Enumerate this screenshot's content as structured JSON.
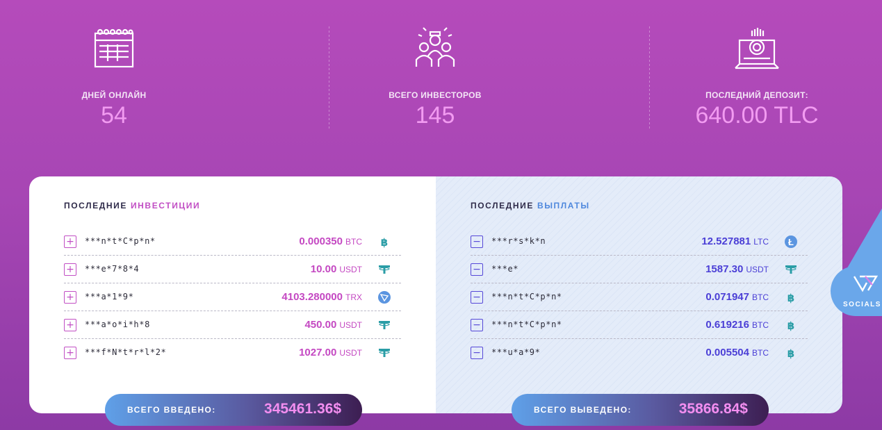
{
  "stats": [
    {
      "icon": "calendar-icon",
      "label": "ДНЕЙ ОНЛАЙН",
      "value": "54"
    },
    {
      "icon": "investors-icon",
      "label": "ВСЕГО ИНВЕСТОРОВ",
      "value": "145"
    },
    {
      "icon": "deposit-icon",
      "label": "ПОСЛЕДНИЙ ДЕПОЗИТ:",
      "value": "640.00 TLC"
    }
  ],
  "investments": {
    "title_prefix": "ПОСЛЕДНИЕ",
    "title_accent": "ИНВЕСТИЦИИ",
    "rows": [
      {
        "user": "***n*t*C*p*n*",
        "amount": "0.000350",
        "currency": "BTC",
        "coin": "bitcoin-icon"
      },
      {
        "user": "***e*7*8*4",
        "amount": "10.00",
        "currency": "USDT",
        "coin": "tether-icon"
      },
      {
        "user": "***a*1*9*",
        "amount": "4103.280000",
        "currency": "TRX",
        "coin": "tron-icon"
      },
      {
        "user": "***a*o*i*h*8",
        "amount": "450.00",
        "currency": "USDT",
        "coin": "tether-icon"
      },
      {
        "user": "***f*N*t*r*l*2*",
        "amount": "1027.00",
        "currency": "USDT",
        "coin": "tether-icon"
      }
    ],
    "total_label": "ВСЕГО ВВЕДЕНО:",
    "total_value": "345461.36$"
  },
  "payouts": {
    "title_prefix": "ПОСЛЕДНИЕ",
    "title_accent": "ВЫПЛАТЫ",
    "rows": [
      {
        "user": "***r*s*k*n",
        "amount": "12.527881",
        "currency": "LTC",
        "coin": "litecoin-icon"
      },
      {
        "user": "***e*",
        "amount": "1587.30",
        "currency": "USDT",
        "coin": "tether-icon"
      },
      {
        "user": "***n*t*C*p*n*",
        "amount": "0.071947",
        "currency": "BTC",
        "coin": "bitcoin-icon"
      },
      {
        "user": "***n*t*C*p*n*",
        "amount": "0.619216",
        "currency": "BTC",
        "coin": "bitcoin-icon"
      },
      {
        "user": "***u*a*9*",
        "amount": "0.005504",
        "currency": "BTC",
        "coin": "bitcoin-icon"
      }
    ],
    "total_label": "ВСЕГО ВЫВЕДЕНО:",
    "total_value": "35866.84$"
  },
  "socials": {
    "label": "SOCIALS",
    "icon": "socials-logo-icon"
  },
  "colors": {
    "background": "#b54bbb",
    "stat_value": "#f29bf1",
    "invest_accent": "#c14ec4",
    "payout_accent": "#4f88dd",
    "payout_amount": "#4b3fd6",
    "coin_teal": "#2a9da6",
    "litecoin": "#5b95e0"
  }
}
